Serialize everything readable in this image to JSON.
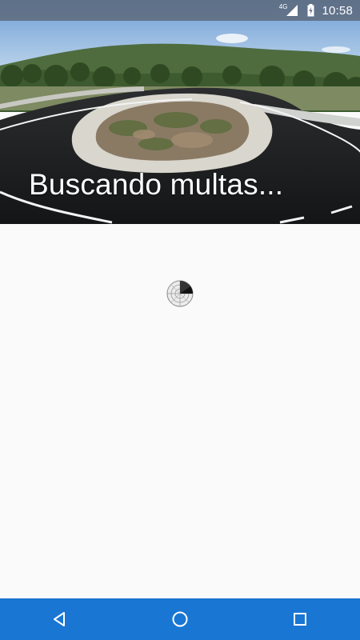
{
  "status_bar": {
    "network": "4G",
    "time": "10:58"
  },
  "header": {
    "title": "Buscando multas..."
  },
  "icons": {
    "signal": "signal-icon",
    "battery": "battery-charging-icon",
    "radar": "radar-loading-icon",
    "back": "back-icon",
    "home": "home-icon",
    "recents": "recents-icon"
  },
  "colors": {
    "nav_bar": "#1976d2",
    "background": "#fafafa"
  }
}
